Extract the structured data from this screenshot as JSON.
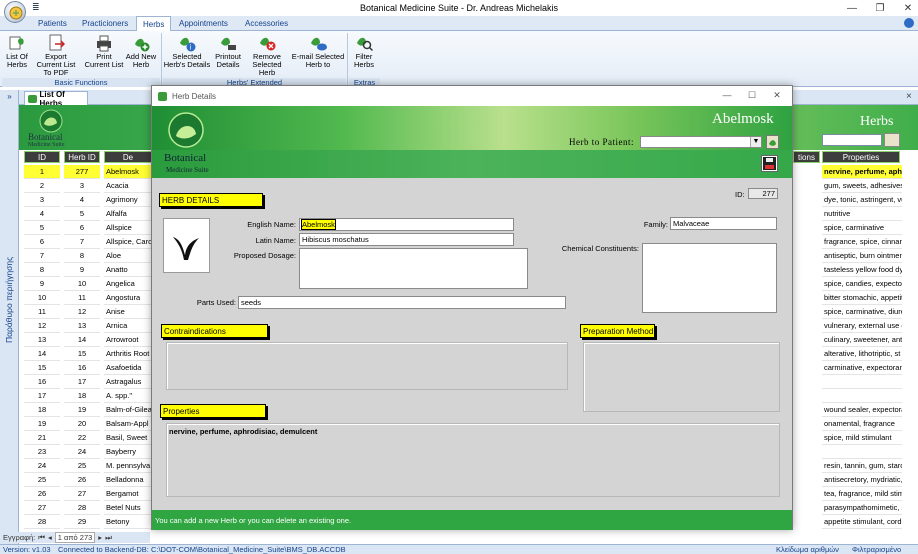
{
  "window": {
    "title": "Botanical Medicine Suite - Dr. Andreas Michelakis",
    "qat": "≣"
  },
  "ribbon": {
    "tabs": [
      "Patients",
      "Practicioners",
      "Herbs",
      "Appointments",
      "Accessories"
    ],
    "active_tab": "Herbs",
    "groups": [
      {
        "label": "Basic Functions",
        "buttons": [
          "List Of Herbs",
          "Export Current List To PDF",
          "Print Current List",
          "Add New Herb"
        ]
      },
      {
        "label": "Herbs' Extended",
        "buttons": [
          "Selected Herb's Details",
          "Printout Details",
          "Remove Selected Herb",
          "E-mail Selected Herb to"
        ]
      },
      {
        "label": "Extras",
        "buttons": [
          "Filter Herbs"
        ]
      }
    ]
  },
  "nav": {
    "collapse": "»",
    "pane_label": "Παράθυρο περιήγησης"
  },
  "list": {
    "tab_label": "List Of Herbs",
    "close": "×",
    "brand": "Botanical",
    "brand_sub": "Medicine Suite",
    "title": "Herbs",
    "columns": [
      "ID",
      "Herb ID",
      "De",
      "tions",
      "Properties"
    ],
    "rows": [
      {
        "id": "1",
        "herb_id": "277",
        "name": "Abelmosk",
        "props": "nervine, perfume, aphro"
      },
      {
        "id": "2",
        "herb_id": "3",
        "name": "Acacia",
        "props": "gum, sweets, adhesives,"
      },
      {
        "id": "3",
        "herb_id": "4",
        "name": "Agrimony",
        "props": "dye, tonic, astringent, vu"
      },
      {
        "id": "4",
        "herb_id": "5",
        "name": "Alfalfa",
        "props": "nutritive"
      },
      {
        "id": "5",
        "herb_id": "6",
        "name": "Allspice",
        "props": "spice, carminative"
      },
      {
        "id": "6",
        "herb_id": "7",
        "name": "Allspice, Caro",
        "props": "fragrance, spice, cinnam"
      },
      {
        "id": "7",
        "herb_id": "8",
        "name": "Aloe",
        "props": "antiseptic, burn ointmen"
      },
      {
        "id": "8",
        "herb_id": "9",
        "name": "Anatto",
        "props": "tasteless yellow food dy"
      },
      {
        "id": "9",
        "herb_id": "10",
        "name": "Angelica",
        "props": "spice, candies, expectora"
      },
      {
        "id": "10",
        "herb_id": "11",
        "name": "Angostura",
        "props": "bitter stomachic, appetit"
      },
      {
        "id": "11",
        "herb_id": "12",
        "name": "Anise",
        "props": "spice, carminative, diure"
      },
      {
        "id": "12",
        "herb_id": "13",
        "name": "Arnica",
        "props": "vulnerary, external use o"
      },
      {
        "id": "13",
        "herb_id": "14",
        "name": "Arrowroot",
        "props": "culinary, sweetener, anti"
      },
      {
        "id": "14",
        "herb_id": "15",
        "name": "Arthritis Root",
        "props": "alterative, lithotriptic, st"
      },
      {
        "id": "15",
        "herb_id": "16",
        "name": "Asafoetida",
        "props": "carminative, expectorant"
      },
      {
        "id": "16",
        "herb_id": "17",
        "name": "Astragalus",
        "props": ""
      },
      {
        "id": "17",
        "herb_id": "18",
        "name": "A. spp.\"",
        "props": ""
      },
      {
        "id": "18",
        "herb_id": "19",
        "name": "Balm-of-Gilea",
        "props": "wound sealer, expectora"
      },
      {
        "id": "19",
        "herb_id": "20",
        "name": "Balsam-Appl",
        "props": "onamental, fragrance"
      },
      {
        "id": "21",
        "herb_id": "22",
        "name": "Basil, Sweet",
        "props": "spice, mild stimulant"
      },
      {
        "id": "23",
        "herb_id": "24",
        "name": "Bayberry",
        "props": ""
      },
      {
        "id": "24",
        "herb_id": "25",
        "name": "M. pennsylva",
        "props": "resin, tannin, gum, starcl"
      },
      {
        "id": "25",
        "herb_id": "26",
        "name": "Belladonna",
        "props": "antisecretory, mydriatic,"
      },
      {
        "id": "26",
        "herb_id": "27",
        "name": "Bergamot",
        "props": "tea, fragrance, mild stim"
      },
      {
        "id": "27",
        "herb_id": "28",
        "name": "Betel Nuts",
        "props": "parasympathomimetic, s"
      },
      {
        "id": "28",
        "herb_id": "29",
        "name": "Betony",
        "props": "appetite stimulant, cordi"
      }
    ],
    "record_nav": {
      "label": "Εγγραφή:",
      "first": "⏮",
      "prev": "◂",
      "position": "1 από 273",
      "next": "▸",
      "last": "⏭"
    }
  },
  "modal": {
    "title": "Herb Details",
    "brand": "Botanical",
    "brand_sub": "Medicine Suite",
    "herb_title": "Abelmosk",
    "herb_to_patient_label": "Herb to Patient:",
    "herb_to_patient_value": "",
    "section_herb_details": "HERB DETAILS",
    "id_label": "ID:",
    "id_value": "277",
    "english_name_label": "English Name:",
    "english_name": "Abelmosk",
    "latin_name_label": "Latin Name:",
    "latin_name": "Hibiscus moschatus",
    "proposed_dosage_label": "Proposed Dosage:",
    "proposed_dosage": "",
    "family_label": "Family:",
    "family": "Malvaceae",
    "chemical_label": "Chemical Constituents:",
    "chemical": "",
    "parts_used_label": "Parts Used:",
    "parts_used": "seeds",
    "section_contraindications": "Contraindications",
    "section_preparation": "Preparation Method",
    "section_properties": "Properties",
    "properties_text": "nervine, perfume, aphrodisiac, demulcent",
    "footer": "You can add a new Herb or you can delete an existing one."
  },
  "status": {
    "version": "Version: v1.03",
    "backend": "Connected to Backend-DB: C:\\DOT-COM\\Botanical_Medicine_Suite\\BMS_DB.ACCDB",
    "numlock": "Κλείδωμα αριθμών",
    "filtered": "Φιλτραρισμένο"
  },
  "colors": {
    "accent_green": "#2fa641",
    "ribbon_blue": "#15428b",
    "highlight": "#ffff00"
  }
}
